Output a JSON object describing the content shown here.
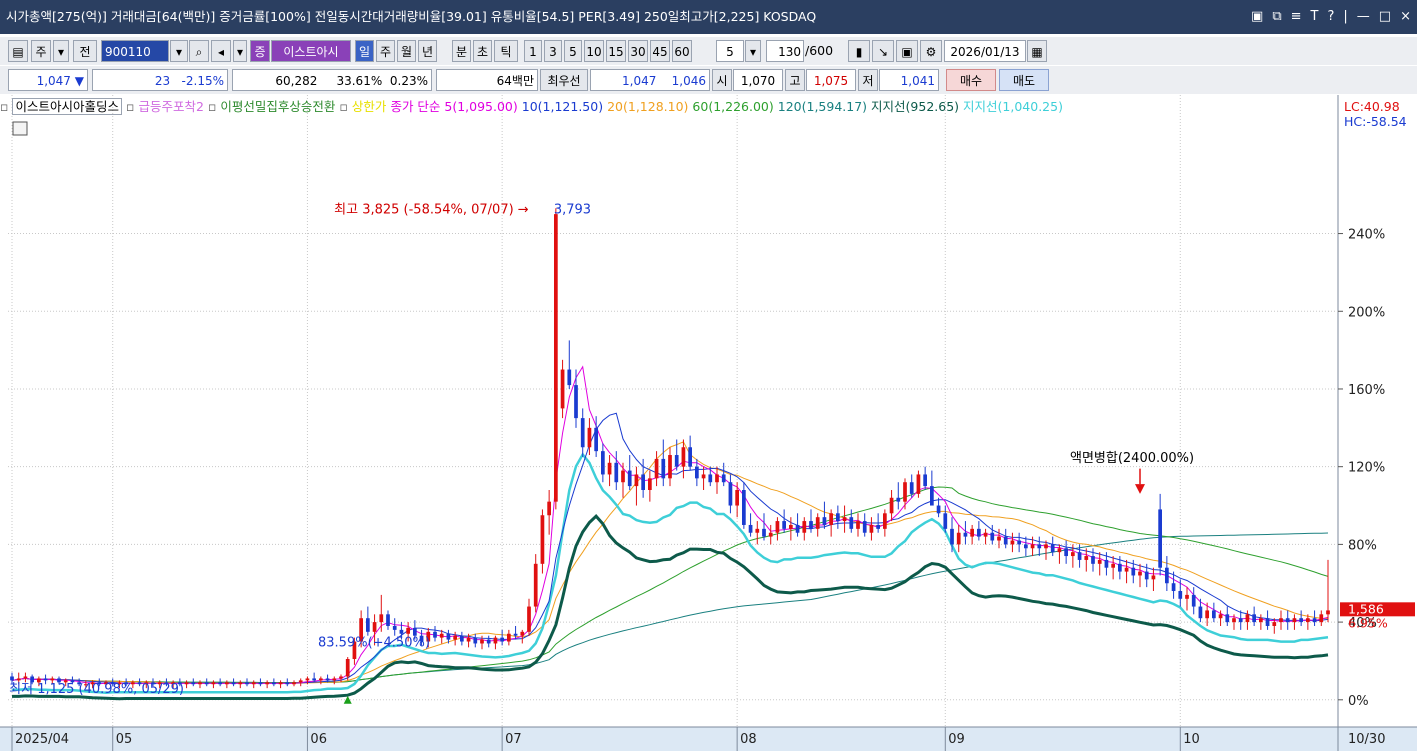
{
  "window": {
    "title": "시가총액[275(억)] 거래대금[64(백만)] 증거금률[100%] 전일동시간대거래량비율[39.01] 유통비율[54.5] PER[3.49] 250일최고가[2,225] KOSDAQ",
    "controls": [
      "▣",
      "⧉",
      "≡",
      "T",
      "?",
      "|",
      "—",
      "□",
      "×"
    ]
  },
  "toolbar": {
    "market": "주",
    "period_prefix": "전",
    "code": "900110",
    "stock_name": "이스트아시",
    "stock_badge": "증",
    "periods": [
      "일",
      "주",
      "월",
      "년",
      "분",
      "초",
      "틱"
    ],
    "active_period": "일",
    "minutes": [
      "1",
      "3",
      "5",
      "10",
      "15",
      "30",
      "45",
      "60"
    ],
    "interval": "5",
    "count": "130",
    "count_total": "/600",
    "date": "2026/01/13"
  },
  "quote": {
    "price": "1,047",
    "arrow": "▼",
    "change": "23",
    "change_pct": "-2.15%",
    "volume": "60,282",
    "turnover": "33.61%",
    "ratio": "0.23%",
    "amount": "64백만",
    "best_label": "최우선",
    "best_ask": "1,047",
    "best_bid": "1,046",
    "open_label": "시",
    "open": "1,070",
    "high_label": "고",
    "high": "1,075",
    "low_label": "저",
    "low": "1,041",
    "buy": "매수",
    "sell": "매도"
  },
  "legend": [
    {
      "text": "이스트아시아홀딩스",
      "color": "#000000"
    },
    {
      "text": "급등주포착2",
      "color": "#d06be0"
    },
    {
      "text": "이평선밀집후상승전환",
      "color": "#2e8b2e"
    },
    {
      "text": "상한가",
      "color": "#e8e000"
    },
    {
      "text": "종가 단순 5(1,095.00)",
      "color": "#e000e0"
    },
    {
      "text": "10(1,121.50)",
      "color": "#1a3bd0"
    },
    {
      "text": "20(1,128.10)",
      "color": "#f0a020"
    },
    {
      "text": "60(1,226.00)",
      "color": "#2ea02e"
    },
    {
      "text": "120(1,594.17)",
      "color": "#1a8080"
    },
    {
      "text": "지지선(952.65)",
      "color": "#0d5a4a"
    },
    {
      "text": "지지선(1,040.25)",
      "color": "#3ecfd8"
    }
  ],
  "lc_hc": {
    "lc": "LC:40.98",
    "hc": "HC:-58.54"
  },
  "chart_data": {
    "type": "candlestick",
    "y_unit": "%",
    "ylim": [
      -14,
      300
    ],
    "y_ticks": [
      "0%",
      "40%",
      "80%",
      "120%",
      "160%",
      "200%",
      "240%"
    ],
    "y_tick_values": [
      0,
      40,
      80,
      120,
      160,
      200,
      240
    ],
    "x_ticks": [
      {
        "label": "2025/04",
        "index": 0
      },
      {
        "label": "05",
        "index": 15
      },
      {
        "label": "06",
        "index": 44
      },
      {
        "label": "07",
        "index": 73
      },
      {
        "label": "08",
        "index": 108
      },
      {
        "label": "09",
        "index": 139
      },
      {
        "label": "10",
        "index": 174
      }
    ],
    "x_end_label": "10/30",
    "current_price_label": "1,586",
    "current_pct_label": "6.95%",
    "current_pct": 44,
    "annotations": [
      {
        "text": "최고 3,825 (-58.54%, 07/07) →",
        "color": "#d00000",
        "index": 80,
        "y": 253
      },
      {
        "text": "3,793",
        "color": "#1a3bd0",
        "index": 81,
        "y": 253
      },
      {
        "text": "83.59%(+4.50%)",
        "color": "#1a3bd0",
        "index": 56,
        "y": 30
      },
      {
        "text": "최저 1,125 (40.98%, 05/29)",
        "color": "#1a3bd0",
        "index": 10,
        "y": 6
      },
      {
        "text": "액면병합(2400.00%)",
        "color": "#000000",
        "index": 168,
        "y": 125
      }
    ],
    "candles": [
      [
        12,
        14,
        8,
        10
      ],
      [
        10,
        14,
        8,
        11
      ],
      [
        11,
        14,
        9,
        12
      ],
      [
        12,
        13,
        8,
        9
      ],
      [
        9,
        12,
        7,
        11
      ],
      [
        11,
        13,
        8,
        10
      ],
      [
        10,
        12,
        8,
        11
      ],
      [
        11,
        12,
        8,
        9
      ],
      [
        9,
        11,
        7,
        10
      ],
      [
        10,
        12,
        8,
        9
      ],
      [
        9,
        11,
        7,
        8
      ],
      [
        8,
        10,
        6,
        8
      ],
      [
        8,
        10,
        6,
        9
      ],
      [
        9,
        11,
        7,
        8
      ],
      [
        8,
        10,
        6,
        9
      ],
      [
        9,
        11,
        7,
        8
      ],
      [
        8,
        10,
        6,
        9
      ],
      [
        9,
        11,
        7,
        8
      ],
      [
        8,
        10,
        6,
        9
      ],
      [
        9,
        11,
        7,
        8
      ],
      [
        8,
        10,
        6,
        9
      ],
      [
        9,
        11,
        7,
        8
      ],
      [
        8,
        10,
        6,
        9
      ],
      [
        9,
        11,
        7,
        8
      ],
      [
        8,
        10,
        6,
        9
      ],
      [
        9,
        11,
        7,
        8
      ],
      [
        8,
        10,
        6,
        9
      ],
      [
        9,
        11,
        7,
        8
      ],
      [
        8,
        10,
        6,
        9
      ],
      [
        9,
        11,
        7,
        8
      ],
      [
        8,
        10,
        6,
        9
      ],
      [
        9,
        11,
        7,
        8
      ],
      [
        8,
        10,
        6,
        9
      ],
      [
        9,
        11,
        7,
        8
      ],
      [
        8,
        10,
        6,
        9
      ],
      [
        9,
        11,
        7,
        8
      ],
      [
        8,
        10,
        6,
        9
      ],
      [
        9,
        11,
        7,
        8
      ],
      [
        8,
        10,
        6,
        9
      ],
      [
        9,
        11,
        7,
        8
      ],
      [
        8,
        10,
        6,
        9
      ],
      [
        9,
        11,
        7,
        8
      ],
      [
        8,
        10,
        7,
        9
      ],
      [
        9,
        11,
        7,
        10
      ],
      [
        10,
        12,
        8,
        11
      ],
      [
        11,
        14,
        9,
        10
      ],
      [
        10,
        12,
        8,
        11
      ],
      [
        11,
        13,
        9,
        10
      ],
      [
        10,
        12,
        8,
        11
      ],
      [
        11,
        13,
        9,
        12
      ],
      [
        12,
        22,
        10,
        21
      ],
      [
        21,
        32,
        18,
        30
      ],
      [
        30,
        46,
        27,
        42
      ],
      [
        42,
        48,
        33,
        35
      ],
      [
        35,
        44,
        28,
        40
      ],
      [
        40,
        54,
        35,
        44
      ],
      [
        44,
        46,
        36,
        38
      ],
      [
        38,
        42,
        33,
        36
      ],
      [
        36,
        40,
        31,
        34
      ],
      [
        34,
        40,
        30,
        37
      ],
      [
        37,
        41,
        31,
        33
      ],
      [
        33,
        36,
        28,
        30
      ],
      [
        30,
        37,
        27,
        35
      ],
      [
        35,
        38,
        30,
        32
      ],
      [
        32,
        36,
        29,
        34
      ],
      [
        34,
        36,
        29,
        31
      ],
      [
        31,
        35,
        28,
        33
      ],
      [
        33,
        35,
        28,
        30
      ],
      [
        30,
        34,
        27,
        32
      ],
      [
        32,
        34,
        27,
        29
      ],
      [
        29,
        33,
        26,
        31
      ],
      [
        31,
        33,
        27,
        29
      ],
      [
        29,
        33,
        26,
        32
      ],
      [
        32,
        36,
        28,
        30
      ],
      [
        30,
        36,
        28,
        34
      ],
      [
        34,
        38,
        31,
        33
      ],
      [
        33,
        36,
        29,
        35
      ],
      [
        35,
        52,
        33,
        48
      ],
      [
        48,
        75,
        45,
        70
      ],
      [
        70,
        98,
        65,
        95
      ],
      [
        95,
        108,
        85,
        102
      ],
      [
        102,
        253,
        98,
        250
      ],
      [
        150,
        175,
        145,
        170
      ],
      [
        170,
        185,
        160,
        162
      ],
      [
        162,
        170,
        140,
        145
      ],
      [
        145,
        150,
        125,
        130
      ],
      [
        130,
        145,
        126,
        140
      ],
      [
        140,
        146,
        125,
        128
      ],
      [
        128,
        132,
        112,
        116
      ],
      [
        116,
        126,
        110,
        122
      ],
      [
        122,
        128,
        108,
        112
      ],
      [
        112,
        122,
        104,
        118
      ],
      [
        118,
        126,
        108,
        110
      ],
      [
        110,
        120,
        100,
        116
      ],
      [
        116,
        124,
        104,
        108
      ],
      [
        108,
        118,
        102,
        114
      ],
      [
        114,
        128,
        110,
        124
      ],
      [
        124,
        134,
        110,
        114
      ],
      [
        114,
        130,
        110,
        126
      ],
      [
        126,
        134,
        118,
        120
      ],
      [
        120,
        134,
        114,
        130
      ],
      [
        130,
        136,
        118,
        120
      ],
      [
        120,
        124,
        110,
        114
      ],
      [
        114,
        120,
        108,
        116
      ],
      [
        116,
        120,
        110,
        112
      ],
      [
        112,
        120,
        106,
        116
      ],
      [
        116,
        122,
        110,
        112
      ],
      [
        112,
        116,
        96,
        100
      ],
      [
        100,
        112,
        94,
        108
      ],
      [
        108,
        112,
        88,
        90
      ],
      [
        90,
        96,
        84,
        86
      ],
      [
        86,
        92,
        80,
        88
      ],
      [
        88,
        96,
        82,
        84
      ],
      [
        84,
        90,
        80,
        86
      ],
      [
        86,
        94,
        82,
        92
      ],
      [
        92,
        98,
        86,
        88
      ],
      [
        88,
        94,
        82,
        90
      ],
      [
        90,
        96,
        84,
        86
      ],
      [
        86,
        94,
        82,
        92
      ],
      [
        92,
        98,
        86,
        88
      ],
      [
        88,
        96,
        84,
        94
      ],
      [
        94,
        102,
        88,
        90
      ],
      [
        90,
        98,
        84,
        96
      ],
      [
        96,
        100,
        88,
        92
      ],
      [
        92,
        100,
        86,
        94
      ],
      [
        94,
        98,
        86,
        88
      ],
      [
        88,
        96,
        84,
        92
      ],
      [
        92,
        96,
        84,
        86
      ],
      [
        86,
        94,
        82,
        90
      ],
      [
        90,
        96,
        86,
        88
      ],
      [
        88,
        98,
        84,
        96
      ],
      [
        96,
        108,
        92,
        104
      ],
      [
        104,
        112,
        98,
        102
      ],
      [
        102,
        114,
        98,
        112
      ],
      [
        112,
        116,
        104,
        106
      ],
      [
        106,
        118,
        104,
        116
      ],
      [
        116,
        120,
        108,
        110
      ],
      [
        110,
        118,
        106,
        100
      ],
      [
        100,
        104,
        94,
        96
      ],
      [
        96,
        100,
        86,
        88
      ],
      [
        88,
        94,
        76,
        80
      ],
      [
        80,
        90,
        76,
        86
      ],
      [
        86,
        92,
        80,
        84
      ],
      [
        84,
        90,
        80,
        88
      ],
      [
        88,
        92,
        82,
        84
      ],
      [
        84,
        88,
        80,
        86
      ],
      [
        86,
        90,
        80,
        82
      ],
      [
        82,
        88,
        78,
        84
      ],
      [
        84,
        88,
        78,
        80
      ],
      [
        80,
        86,
        76,
        82
      ],
      [
        82,
        86,
        76,
        80
      ],
      [
        80,
        84,
        74,
        78
      ],
      [
        78,
        84,
        74,
        80
      ],
      [
        80,
        84,
        74,
        78
      ],
      [
        78,
        82,
        72,
        80
      ],
      [
        80,
        84,
        74,
        76
      ],
      [
        76,
        80,
        70,
        78
      ],
      [
        78,
        82,
        70,
        74
      ],
      [
        74,
        80,
        68,
        76
      ],
      [
        76,
        80,
        68,
        72
      ],
      [
        72,
        78,
        66,
        74
      ],
      [
        74,
        78,
        66,
        70
      ],
      [
        70,
        76,
        64,
        72
      ],
      [
        72,
        76,
        64,
        68
      ],
      [
        68,
        74,
        62,
        70
      ],
      [
        70,
        74,
        62,
        66
      ],
      [
        66,
        72,
        60,
        68
      ],
      [
        68,
        72,
        60,
        64
      ],
      [
        64,
        70,
        58,
        66
      ],
      [
        66,
        70,
        58,
        62
      ],
      [
        62,
        68,
        56,
        64
      ],
      [
        98,
        106,
        64,
        68
      ],
      [
        68,
        74,
        56,
        60
      ],
      [
        60,
        66,
        52,
        56
      ],
      [
        56,
        62,
        48,
        52
      ],
      [
        52,
        58,
        46,
        54
      ],
      [
        54,
        58,
        44,
        48
      ],
      [
        48,
        52,
        40,
        42
      ],
      [
        42,
        50,
        38,
        46
      ],
      [
        46,
        50,
        40,
        42
      ],
      [
        42,
        46,
        38,
        44
      ],
      [
        44,
        48,
        38,
        40
      ],
      [
        40,
        44,
        36,
        42
      ],
      [
        42,
        46,
        36,
        40
      ],
      [
        40,
        46,
        36,
        44
      ],
      [
        44,
        48,
        38,
        40
      ],
      [
        40,
        44,
        36,
        42
      ],
      [
        42,
        46,
        36,
        38
      ],
      [
        38,
        42,
        34,
        40
      ],
      [
        40,
        46,
        36,
        42
      ],
      [
        42,
        46,
        36,
        40
      ],
      [
        40,
        44,
        36,
        42
      ],
      [
        42,
        46,
        38,
        40
      ],
      [
        40,
        44,
        36,
        42
      ],
      [
        42,
        46,
        38,
        40
      ],
      [
        40,
        46,
        38,
        44
      ],
      [
        44,
        72,
        40,
        46
      ]
    ],
    "lines": {
      "ma5": {
        "color": "#e000e0"
      },
      "ma10": {
        "color": "#1a3bd0"
      },
      "ma20": {
        "color": "#f0a020"
      },
      "ma60": {
        "color": "#2ea02e"
      },
      "ma120": {
        "color": "#1a8080"
      },
      "support1": {
        "color": "#0d5a4a"
      },
      "support2": {
        "color": "#3ecfd8"
      }
    }
  }
}
